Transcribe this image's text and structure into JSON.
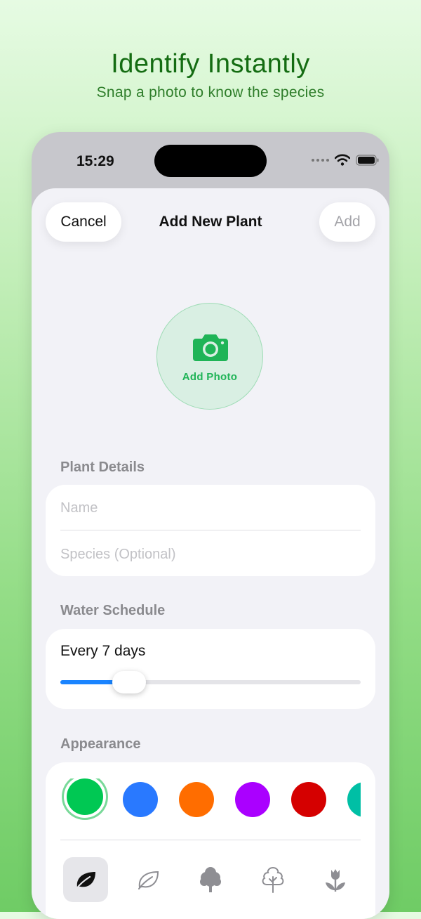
{
  "promo": {
    "headline": "Identify Instantly",
    "subline": "Snap a photo to know the species"
  },
  "status_bar": {
    "time": "15:29"
  },
  "nav": {
    "cancel": "Cancel",
    "title": "Add New Plant",
    "add": "Add"
  },
  "photo": {
    "label": "Add Photo",
    "icon": "camera-icon"
  },
  "plant_details": {
    "section": "Plant Details",
    "name_placeholder": "Name",
    "species_placeholder": "Species (Optional)"
  },
  "water": {
    "section": "Water Schedule",
    "label": "Every 7 days",
    "slider_fraction": 0.23
  },
  "appearance": {
    "section": "Appearance",
    "colors": [
      "#00c853",
      "#2979ff",
      "#ff6d00",
      "#aa00ff",
      "#d50000",
      "#00bfa5"
    ],
    "selected_color_index": 0,
    "icons": [
      "leaf-filled-icon",
      "leaf-outline-icon",
      "tree-filled-icon",
      "tree-outline-icon",
      "tulip-icon"
    ],
    "selected_icon_index": 0
  },
  "colors": {
    "accent_green": "#1fb457",
    "slider_blue": "#1a84ff",
    "headline_green": "#146c12"
  }
}
